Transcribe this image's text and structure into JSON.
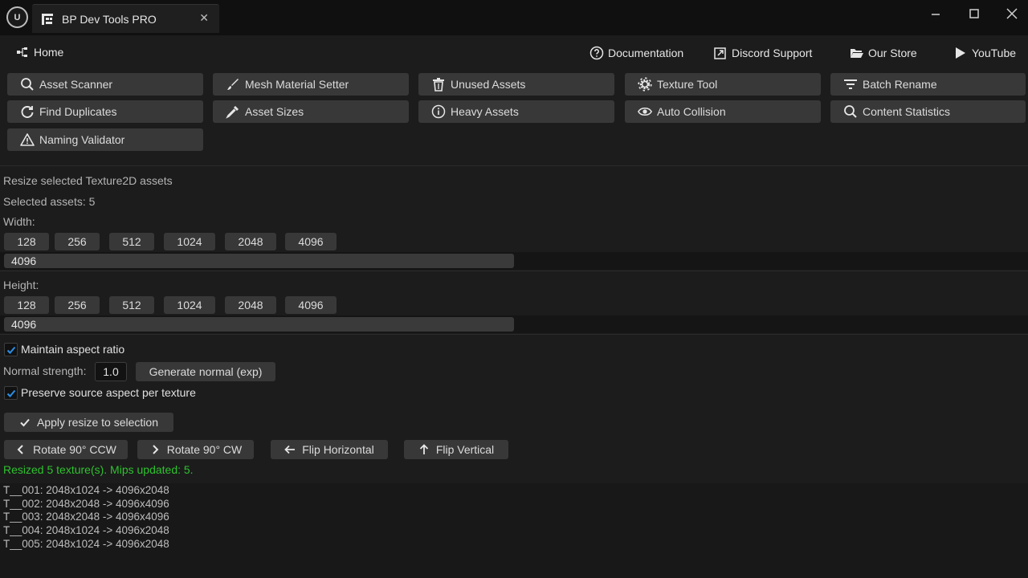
{
  "window": {
    "tab_title": "BP Dev Tools PRO",
    "close_glyph": "✕"
  },
  "toolbar": {
    "home_label": "Home",
    "links": [
      {
        "label": "Documentation",
        "icon": "question-circle-icon"
      },
      {
        "label": "Discord Support",
        "icon": "external-link-icon"
      },
      {
        "label": "Our Store",
        "icon": "folder-open-icon"
      },
      {
        "label": "YouTube",
        "icon": "play-icon"
      }
    ]
  },
  "tools": [
    {
      "label": "Asset Scanner",
      "icon": "search-icon"
    },
    {
      "label": "Mesh Material Setter",
      "icon": "brush-icon"
    },
    {
      "label": "Unused Assets",
      "icon": "trash-icon"
    },
    {
      "label": "Texture Tool",
      "icon": "gear-icon"
    },
    {
      "label": "Batch Rename",
      "icon": "filter-icon"
    },
    {
      "label": "Find Duplicates",
      "icon": "refresh-icon"
    },
    {
      "label": "Asset Sizes",
      "icon": "eyedropper-icon"
    },
    {
      "label": "Heavy Assets",
      "icon": "info-icon"
    },
    {
      "label": "Auto Collision",
      "icon": "eye-icon"
    },
    {
      "label": "Content Statistics",
      "icon": "search-icon"
    },
    {
      "label": "Naming Validator",
      "icon": "warning-icon"
    }
  ],
  "resize": {
    "heading": "Resize selected Texture2D assets",
    "selected": "Selected assets: 5",
    "width_label": "Width:",
    "height_label": "Height:",
    "presets": [
      "128",
      "256",
      "512",
      "1024",
      "2048",
      "4096"
    ],
    "width_value": "4096",
    "height_value": "4096",
    "maintain_aspect": "Maintain aspect ratio",
    "normal_strength_label": "Normal strength:",
    "normal_strength_value": "1.0",
    "generate_normal": "Generate normal (exp)",
    "preserve_aspect": "Preserve source aspect per texture",
    "apply": "Apply resize to selection"
  },
  "actions": [
    {
      "label": "Rotate 90° CCW",
      "icon": "chevron-left-icon"
    },
    {
      "label": "Rotate 90° CW",
      "icon": "chevron-right-icon"
    },
    {
      "label": "Flip Horizontal",
      "icon": "arrow-left-icon"
    },
    {
      "label": "Flip Vertical",
      "icon": "arrow-up-icon"
    }
  ],
  "status": "Resized 5 texture(s). Mips updated: 5.",
  "log": [
    "T__001: 2048x1024 -> 4096x2048",
    "T__002: 2048x2048 -> 4096x4096",
    "T__003: 2048x2048 -> 4096x4096",
    "T__004: 2048x1024 -> 4096x2048",
    "T__005: 2048x1024 -> 4096x2048"
  ],
  "colors": {
    "background": "#1c1c1c",
    "button": "#383838",
    "status_green": "#2ec22e",
    "check_blue": "#2a8fe8"
  }
}
